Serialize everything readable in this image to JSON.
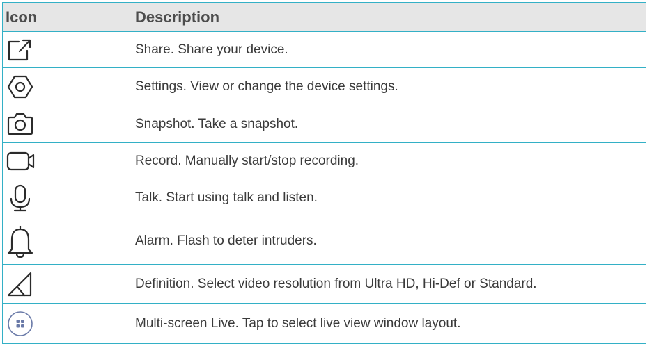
{
  "table": {
    "headers": {
      "icon": "Icon",
      "description": "Description"
    },
    "rows": [
      {
        "icon": "share-icon",
        "description": "Share. Share your device."
      },
      {
        "icon": "settings-icon",
        "description": "Settings. View or change the device settings."
      },
      {
        "icon": "camera-icon",
        "description": "Snapshot. Take a snapshot."
      },
      {
        "icon": "video-camera-icon",
        "description": "Record. Manually start/stop recording."
      },
      {
        "icon": "microphone-icon",
        "description": "Talk. Start using talk and listen."
      },
      {
        "icon": "bell-icon",
        "description": "Alarm. Flash to deter intruders."
      },
      {
        "icon": "signal-triangle-icon",
        "description": "Definition. Select video resolution from Ultra HD, Hi-Def or Standard."
      },
      {
        "icon": "multi-screen-icon",
        "description": "Multi-screen Live. Tap to select live view window layout."
      }
    ]
  },
  "colors": {
    "border": "#33b0c6",
    "header_background": "#e6e6e6",
    "header_text": "#4d4d4d",
    "body_text": "#3a3a3a",
    "icon_stroke": "#2b2b2b"
  }
}
